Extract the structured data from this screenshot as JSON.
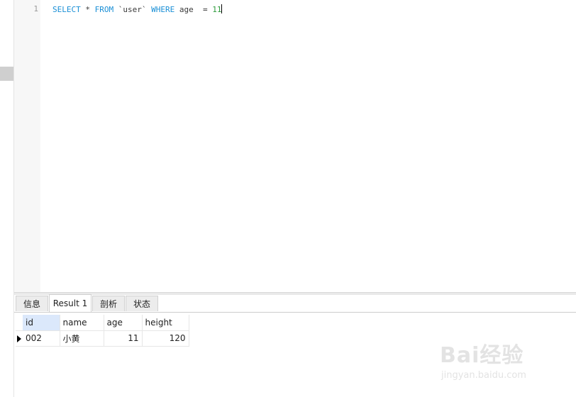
{
  "editor": {
    "line_number": "1",
    "tokens": {
      "select": "SELECT",
      "star": " * ",
      "from": "FROM",
      "table": " `user` ",
      "where": "WHERE",
      "condition": " age  = ",
      "value": "11"
    }
  },
  "result_tabs": [
    {
      "label": "信息"
    },
    {
      "label": "Result 1"
    },
    {
      "label": "剖析"
    },
    {
      "label": "状态"
    }
  ],
  "grid": {
    "columns": [
      "id",
      "name",
      "age",
      "height"
    ],
    "rows": [
      [
        "002",
        "小黄",
        "11",
        "120"
      ]
    ]
  },
  "watermark": {
    "main": "Bai经验",
    "sub": "jingyan.baidu.com"
  },
  "colors": {
    "keyword": "#1a8fd6",
    "number": "#2e9b3c",
    "selected_header": "#dbe8fb"
  }
}
